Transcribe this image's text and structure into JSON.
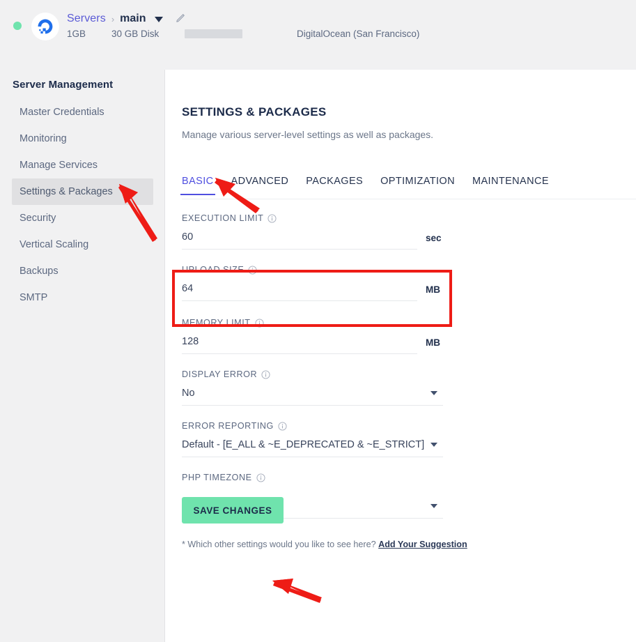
{
  "header": {
    "status": "online",
    "logo_icon": "digitalocean-logo",
    "breadcrumb": {
      "root": "Servers",
      "separator": "›",
      "current": "main",
      "caret_icon": "chevron-down-icon",
      "edit_icon": "pencil-icon"
    },
    "meta": {
      "ram": "1GB",
      "disk": "30 GB Disk",
      "ip_redacted": "",
      "provider": "DigitalOcean (San Francisco)"
    }
  },
  "sidebar": {
    "title": "Server Management",
    "items": [
      {
        "label": "Master Credentials",
        "active": false
      },
      {
        "label": "Monitoring",
        "active": false
      },
      {
        "label": "Manage Services",
        "active": false
      },
      {
        "label": "Settings & Packages",
        "active": true
      },
      {
        "label": "Security",
        "active": false
      },
      {
        "label": "Vertical Scaling",
        "active": false
      },
      {
        "label": "Backups",
        "active": false
      },
      {
        "label": "SMTP",
        "active": false
      }
    ]
  },
  "main": {
    "title": "SETTINGS & PACKAGES",
    "subtitle": "Manage various server-level settings as well as packages.",
    "tabs": [
      {
        "label": "BASIC",
        "active": true
      },
      {
        "label": "ADVANCED",
        "active": false
      },
      {
        "label": "PACKAGES",
        "active": false
      },
      {
        "label": "OPTIMIZATION",
        "active": false
      },
      {
        "label": "MAINTENANCE",
        "active": false
      }
    ],
    "fields": [
      {
        "label": "EXECUTION LIMIT",
        "value": "60",
        "unit": "sec",
        "type": "number",
        "info_icon": "info-icon"
      },
      {
        "label": "UPLOAD SIZE",
        "value": "64",
        "unit": "MB",
        "type": "number",
        "info_icon": "info-icon"
      },
      {
        "label": "MEMORY LIMIT",
        "value": "128",
        "unit": "MB",
        "type": "number",
        "info_icon": "info-icon"
      },
      {
        "label": "DISPLAY ERROR",
        "value": "No",
        "unit": "",
        "type": "select",
        "info_icon": "info-icon"
      },
      {
        "label": "ERROR REPORTING",
        "value": "Default - [E_ALL & ~E_DEPRECATED & ~E_STRICT]",
        "unit": "",
        "type": "select",
        "info_icon": "info-icon"
      },
      {
        "label": "PHP TIMEZONE",
        "value": "",
        "unit": "",
        "type": "select",
        "info_icon": "info-icon"
      }
    ],
    "save_label": "SAVE CHANGES",
    "footnote_text": "* Which other settings would you like to see here? ",
    "footnote_link": "Add Your Suggestion"
  },
  "annotations": {
    "highlight_color": "#ee1c16",
    "arrow_color": "#ee1c16",
    "highlighted_field": "UPLOAD SIZE",
    "arrows": [
      {
        "points_to": "sidebar-item-settings-packages"
      },
      {
        "points_to": "tab-basic"
      },
      {
        "points_to": "save-changes-button"
      }
    ]
  },
  "colors": {
    "accent": "#4f4fe0",
    "save_button": "#6fe3ad",
    "status_dot": "#6fe3ad",
    "page_bg": "#f1f1f2",
    "panel_bg": "#ffffff",
    "text_dark": "#1c2b4a",
    "text_muted": "#5c6880"
  }
}
